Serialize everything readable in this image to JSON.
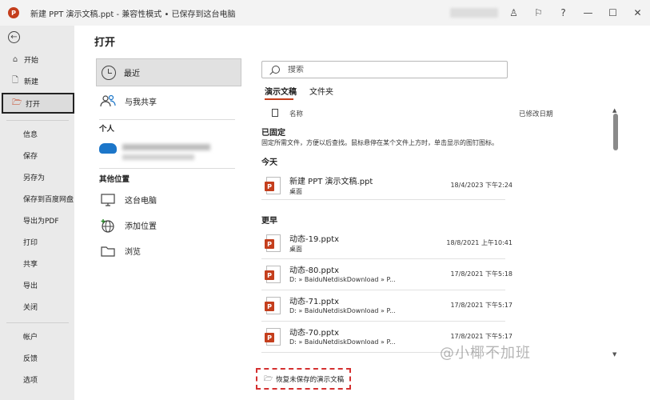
{
  "titlebar": {
    "app_logo_text": "P",
    "title": "新建 PPT 演示文稿.ppt  -  兼容性模式  •  已保存到这台电脑",
    "icons": [
      "person-icon",
      "feedback-icon",
      "help-icon",
      "minimize-icon",
      "maximize-icon",
      "close-icon"
    ],
    "minimize_glyph": "—",
    "maximize_glyph": "☐",
    "close_glyph": "✕",
    "help_glyph": "?",
    "person_glyph": "♙",
    "feedback_glyph": "⚐"
  },
  "nav": {
    "back_glyph": "←",
    "top_items": [
      {
        "label": "开始",
        "icon": "home-icon",
        "glyph": "⌂"
      },
      {
        "label": "新建",
        "icon": "new-doc-icon",
        "glyph": "🗋"
      },
      {
        "label": "打开",
        "icon": "folder-open-icon",
        "glyph": "🗁"
      }
    ],
    "mid_items": [
      "信息",
      "保存",
      "另存为",
      "保存到百度网盘",
      "导出为PDF",
      "打印",
      "共享",
      "导出",
      "关闭"
    ],
    "bottom_items": [
      "帐户",
      "反馈",
      "选项"
    ]
  },
  "main": {
    "title": "打开",
    "locations": {
      "recent": "最近",
      "shared": "与我共享",
      "personal_header": "个人",
      "other_header": "其他位置",
      "this_pc": "这台电脑",
      "add_place": "添加位置",
      "browse": "浏览"
    },
    "search": {
      "placeholder": "搜索"
    },
    "tabs": [
      "演示文稿",
      "文件夹"
    ],
    "file_header": {
      "name": "名称",
      "modified": "已修改日期"
    },
    "pinned": {
      "title": "已固定",
      "note": "固定所需文件，方便以后查找。鼠标悬停在某个文件上方时，单击显示的图钉图标。"
    },
    "today": {
      "title": "今天",
      "files": [
        {
          "name": "新建 PPT 演示文稿.ppt",
          "path": "桌面",
          "date": "18/4/2023 下午2:24"
        }
      ]
    },
    "earlier": {
      "title": "更早",
      "files": [
        {
          "name": "动态-19.pptx",
          "path": "桌面",
          "date": "18/8/2021 上午10:41"
        },
        {
          "name": "动态-80.pptx",
          "path": "D: » BaiduNetdiskDownload » P...",
          "date": "17/8/2021 下午5:18"
        },
        {
          "name": "动态-71.pptx",
          "path": "D: » BaiduNetdiskDownload » P...",
          "date": "17/8/2021 下午5:17"
        },
        {
          "name": "动态-70.pptx",
          "path": "D: » BaiduNetdiskDownload » P...",
          "date": "17/8/2021 下午5:17"
        }
      ]
    },
    "recover_button": "恢复未保存的演示文稿",
    "watermark": "@小椰不加班"
  },
  "colors": {
    "accent": "#c43e1c",
    "highlight_border": "#d43030"
  }
}
